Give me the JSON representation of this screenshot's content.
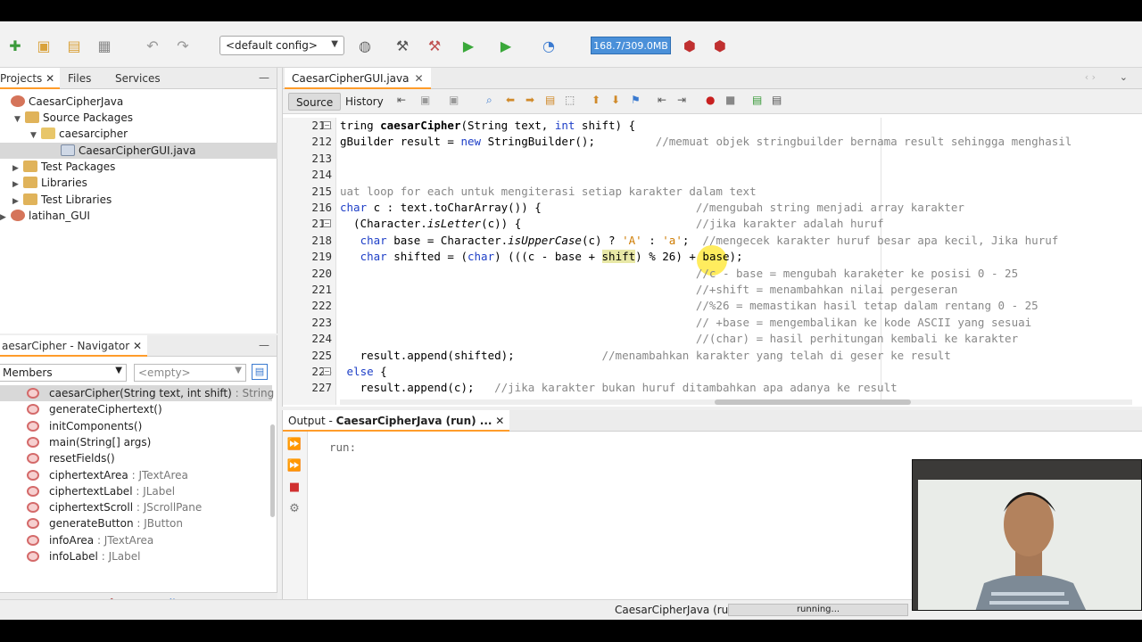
{
  "toolbar": {
    "config": "<default config>",
    "memory": "168.7/309.0MB"
  },
  "projects": {
    "tabs": [
      "Projects",
      "Files",
      "Services"
    ],
    "tree": [
      {
        "label": "CaesarCipherJava",
        "indent": 0,
        "icon": "project-icon"
      },
      {
        "label": "Source Packages",
        "indent": 1,
        "icon": "source-packages-icon"
      },
      {
        "label": "caesarcipher",
        "indent": 2,
        "icon": "package-icon"
      },
      {
        "label": "CaesarCipherGUI.java",
        "indent": 3,
        "icon": "java-file-icon",
        "selected": true
      },
      {
        "label": "Test Packages",
        "indent": 1,
        "icon": "folder-icon"
      },
      {
        "label": "Libraries",
        "indent": 1,
        "icon": "folder-icon"
      },
      {
        "label": "Test Libraries",
        "indent": 1,
        "icon": "folder-icon"
      },
      {
        "label": "latihan_GUI",
        "indent": 0,
        "icon": "project-icon"
      }
    ]
  },
  "navigator": {
    "title": "aesarCipher - Navigator",
    "members_label": "Members",
    "filter": "<empty>",
    "items": [
      {
        "name": "caesarCipher(String text, int shift)",
        "type": " : String",
        "selected": true
      },
      {
        "name": "generateCiphertext()",
        "type": ""
      },
      {
        "name": "initComponents()",
        "type": ""
      },
      {
        "name": "main(String[] args)",
        "type": ""
      },
      {
        "name": "resetFields()",
        "type": ""
      },
      {
        "name": "ciphertextArea",
        "type": " : JTextArea"
      },
      {
        "name": "ciphertextLabel",
        "type": " : JLabel"
      },
      {
        "name": "ciphertextScroll",
        "type": " : JScrollPane"
      },
      {
        "name": "generateButton",
        "type": " : JButton"
      },
      {
        "name": "infoArea",
        "type": " : JTextArea"
      },
      {
        "name": "infoLabel",
        "type": " : JLabel"
      }
    ]
  },
  "editor": {
    "tab": "CaesarCipherGUI.java",
    "source_label": "Source",
    "history_label": "History",
    "line_numbers": [
      "211",
      "212",
      "213",
      "214",
      "215",
      "216",
      "217",
      "218",
      "219",
      "220",
      "221",
      "222",
      "223",
      "224",
      "225",
      "226",
      "227"
    ]
  },
  "output": {
    "tab_prefix": "Output - ",
    "tab_title": "CaesarCipherJava (run) ...",
    "text": "run:"
  },
  "status": {
    "task": "CaesarCipherJava (run)",
    "progress_text": "running..."
  },
  "colors": {
    "accent": "#ff9c2a",
    "keyword": "#1e3fc7",
    "comment": "#888888",
    "string": "#ce7b00"
  }
}
